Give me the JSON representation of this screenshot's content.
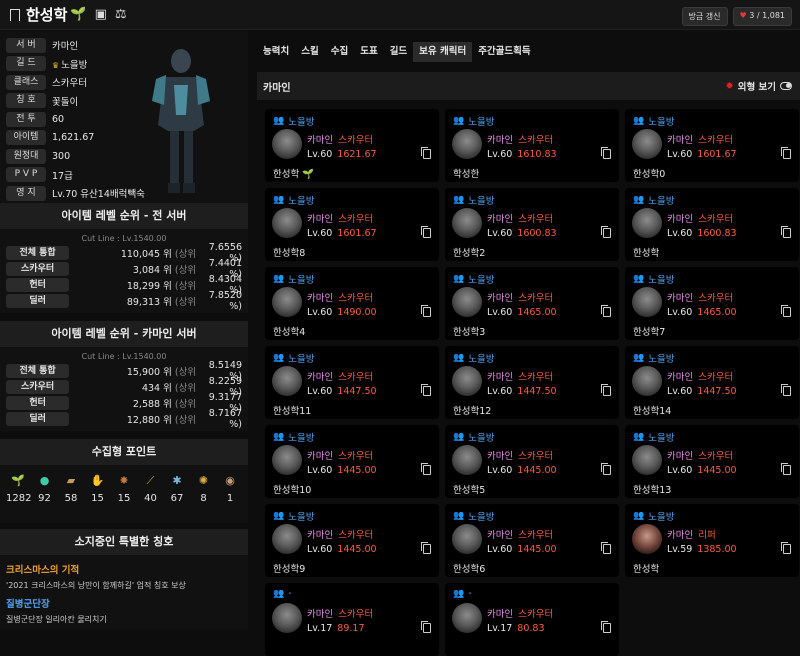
{
  "topbar": {
    "title": "한성학",
    "refresh_label": "방금 갱신",
    "likes": "3 / 1,081"
  },
  "profile": {
    "rows": [
      {
        "label": "서 버",
        "value": "카마인"
      },
      {
        "label": "길 드",
        "value": "노을방",
        "crown": true
      },
      {
        "label": "클래스",
        "value": "스카우터"
      },
      {
        "label": "칭 호",
        "value": "꽃돌이"
      },
      {
        "label": "전 투",
        "value": "60"
      },
      {
        "label": "아이템",
        "value": "1,621.67"
      },
      {
        "label": "원정대",
        "value": "300"
      },
      {
        "label": "P V P",
        "value": "17급"
      },
      {
        "label": "영 지",
        "value": "Lv.70 유산14배럭빽숙"
      }
    ]
  },
  "rank_all": {
    "title": "아이템 레벨 순위 - 전 서버",
    "cutline": "Cut Line : Lv.1540.00",
    "rows": [
      {
        "label": "전체 통합",
        "rank": "110,045 위",
        "sub": "(상위",
        "pct": "7.6556 %)"
      },
      {
        "label": "스카우터",
        "rank": "3,084 위",
        "sub": "(상위",
        "pct": "7.4401 %)"
      },
      {
        "label": "헌터",
        "rank": "18,299 위",
        "sub": "(상위",
        "pct": "8.4304 %)"
      },
      {
        "label": "딜러",
        "rank": "89,313 위",
        "sub": "(상위",
        "pct": "7.8520 %)"
      }
    ]
  },
  "rank_server": {
    "title": "아이템 레벨 순위 - 카마인 서버",
    "cutline": "Cut Line : Lv.1540.00",
    "rows": [
      {
        "label": "전체 통합",
        "rank": "15,900 위",
        "sub": "(상위",
        "pct": "8.5149 %)"
      },
      {
        "label": "스카우터",
        "rank": "434 위",
        "sub": "(상위",
        "pct": "8.2259 %)"
      },
      {
        "label": "헌터",
        "rank": "2,588 위",
        "sub": "(상위",
        "pct": "9.3177 %)"
      },
      {
        "label": "딜러",
        "rank": "12,880 위",
        "sub": "(상위",
        "pct": "8.7167 %)"
      }
    ]
  },
  "collect": {
    "title": "수집형 포인트",
    "items": [
      {
        "icon": "mokoko-seed-icon",
        "glyph": "🌱",
        "color": "#9acd32",
        "value": "1282"
      },
      {
        "icon": "island-heart-icon",
        "glyph": "●",
        "color": "#3ec9a7",
        "value": "92"
      },
      {
        "icon": "art-icon",
        "glyph": "▰",
        "color": "#c89a5a",
        "value": "58"
      },
      {
        "icon": "giant-heart-icon",
        "glyph": "✋",
        "color": "#cfcfcf",
        "value": "15"
      },
      {
        "icon": "ignea-token-icon",
        "glyph": "✸",
        "color": "#c07a3a",
        "value": "15"
      },
      {
        "icon": "voyage-icon",
        "glyph": "⟋",
        "color": "#d8a040",
        "value": "40"
      },
      {
        "icon": "star-icon",
        "glyph": "✱",
        "color": "#7ab8e0",
        "value": "67"
      },
      {
        "icon": "world-tree-leaf-icon",
        "glyph": "✺",
        "color": "#e0b040",
        "value": "8"
      },
      {
        "icon": "orpheus-star-icon",
        "glyph": "◉",
        "color": "#c8a070",
        "value": "1"
      }
    ]
  },
  "titles": {
    "title": "소지중인 특별한 칭호",
    "t1_name": "크리스마스의 기적",
    "t1_desc": "'2021 크리스마스의 낭만이 함께하길' 업적 칭호 보상",
    "t2_name": "질병군단장",
    "t2_desc": "질병군단장 일리아칸 물리치기"
  },
  "tabs": [
    "능력치",
    "스킬",
    "수집",
    "도표",
    "길드",
    "보유 캐릭터",
    "주간골드획득"
  ],
  "active_tab": 5,
  "charbar": {
    "server": "카마인",
    "toggle_label": "외형 보기"
  },
  "characters": [
    {
      "guild": "노을방",
      "server": "카마인",
      "cls": "스카우터",
      "lv": "Lv.60",
      "il": "1621.67",
      "name": "한성학",
      "leaf": true,
      "avatar": "gray"
    },
    {
      "guild": "노을방",
      "server": "카마인",
      "cls": "스카우터",
      "lv": "Lv.60",
      "il": "1610.83",
      "name": "학성한",
      "avatar": "gray"
    },
    {
      "guild": "노을방",
      "server": "카마인",
      "cls": "스카우터",
      "lv": "Lv.60",
      "il": "1601.67",
      "name": "한성학0",
      "avatar": "gray"
    },
    {
      "guild": "노을방",
      "server": "카마인",
      "cls": "스카우터",
      "lv": "Lv.60",
      "il": "1601.67",
      "name": "한성학8",
      "avatar": "gray"
    },
    {
      "guild": "노을방",
      "server": "카마인",
      "cls": "스카우터",
      "lv": "Lv.60",
      "il": "1600.83",
      "name": "한성학2",
      "avatar": "gray"
    },
    {
      "guild": "노을방",
      "server": "카마인",
      "cls": "스카우터",
      "lv": "Lv.60",
      "il": "1600.83",
      "name": "한성학",
      "avatar": "gray"
    },
    {
      "guild": "노을방",
      "server": "카마인",
      "cls": "스카우터",
      "lv": "Lv.60",
      "il": "1490.00",
      "name": "한성학4",
      "avatar": "gray"
    },
    {
      "guild": "노을방",
      "server": "카마인",
      "cls": "스카우터",
      "lv": "Lv.60",
      "il": "1465.00",
      "name": "한성학3",
      "avatar": "gray"
    },
    {
      "guild": "노을방",
      "server": "카마인",
      "cls": "스카우터",
      "lv": "Lv.60",
      "il": "1465.00",
      "name": "한성학7",
      "avatar": "gray"
    },
    {
      "guild": "노을방",
      "server": "카마인",
      "cls": "스카우터",
      "lv": "Lv.60",
      "il": "1447.50",
      "name": "한성학11",
      "avatar": "gray"
    },
    {
      "guild": "노을방",
      "server": "카마인",
      "cls": "스카우터",
      "lv": "Lv.60",
      "il": "1447.50",
      "name": "한성학12",
      "avatar": "gray"
    },
    {
      "guild": "노을방",
      "server": "카마인",
      "cls": "스카우터",
      "lv": "Lv.60",
      "il": "1447.50",
      "name": "한성학14",
      "avatar": "gray"
    },
    {
      "guild": "노을방",
      "server": "카마인",
      "cls": "스카우터",
      "lv": "Lv.60",
      "il": "1445.00",
      "name": "한성학10",
      "avatar": "gray"
    },
    {
      "guild": "노을방",
      "server": "카마인",
      "cls": "스카우터",
      "lv": "Lv.60",
      "il": "1445.00",
      "name": "한성학5",
      "avatar": "gray"
    },
    {
      "guild": "노을방",
      "server": "카마인",
      "cls": "스카우터",
      "lv": "Lv.60",
      "il": "1445.00",
      "name": "한성학13",
      "avatar": "gray"
    },
    {
      "guild": "노을방",
      "server": "카마인",
      "cls": "스카우터",
      "lv": "Lv.60",
      "il": "1445.00",
      "name": "한성학9",
      "avatar": "gray"
    },
    {
      "guild": "노을방",
      "server": "카마인",
      "cls": "스카우터",
      "lv": "Lv.60",
      "il": "1445.00",
      "name": "한성학6",
      "avatar": "gray"
    },
    {
      "guild": "노을방",
      "server": "카마인",
      "cls": "리퍼",
      "lv": "Lv.59",
      "il": "1385.00",
      "name": "한성학",
      "avatar": "red"
    },
    {
      "guild": "-",
      "server": "카마인",
      "cls": "스카우터",
      "lv": "Lv.17",
      "il": "89.17",
      "name": "",
      "avatar": "gray"
    },
    {
      "guild": "-",
      "server": "카마인",
      "cls": "스카우터",
      "lv": "Lv.17",
      "il": "80.83",
      "name": "",
      "avatar": "gray"
    }
  ]
}
